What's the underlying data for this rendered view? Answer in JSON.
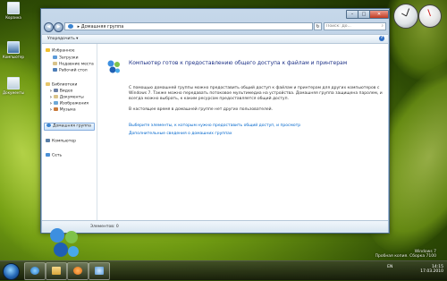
{
  "window": {
    "title_buttons": {
      "minimize": "–",
      "maximize": "□",
      "close": "✕"
    },
    "nav": {
      "back": "◀",
      "forward": "▶"
    },
    "address": {
      "separator": "▸",
      "location": "Домашняя группа"
    },
    "search": {
      "placeholder": "Поиск: До..."
    },
    "command_bar": {
      "organize_label": "Упорядочить ▾",
      "help_label": "?"
    }
  },
  "nav_pane": {
    "favorites": {
      "label": "Избранное",
      "items": [
        "Загрузки",
        "Недавние места",
        "Рабочий стол"
      ]
    },
    "libraries": {
      "label": "Библиотеки",
      "items": [
        "Видео",
        "Документы",
        "Изображения",
        "Музыка"
      ]
    },
    "homegroup": "Домашняя группа",
    "computer": "Компьютер",
    "network": "Сеть"
  },
  "content": {
    "title": "Компьютер готов к предоставлению общего доступа к файлам и принтерам",
    "description": "С помощью домашней группы можно предоставить общий доступ к файлам и принтерам для других компьютеров с Windows 7. Также можно передавать потоковое мультимедиа на устройства. Домашняя группа защищена паролем, и всегда можно выбрать, к каким ресурсам предоставляется общий доступ.",
    "status": "В настоящее время в домашней группе нет других пользователей.",
    "link_share": "Выберите элементы, к которым нужно предоставить общий доступ, и просмотр",
    "link_more": "Дополнительные сведения о домашних группах"
  },
  "details_pane": {
    "items_count": "Элементов: 0"
  },
  "desktop": {
    "icons": [
      "Корзина",
      "Компьютер",
      "Документы"
    ]
  },
  "taskbar": {
    "lang": "EN",
    "time": "14:15",
    "date": "17.03.2010"
  },
  "watermark": {
    "line1": "Windows 7",
    "line2": "Пробная копия. Сборка 7100"
  },
  "colors": {
    "accent": "#1e3287",
    "link": "#0066cc",
    "selection": "#cfe5fa"
  }
}
